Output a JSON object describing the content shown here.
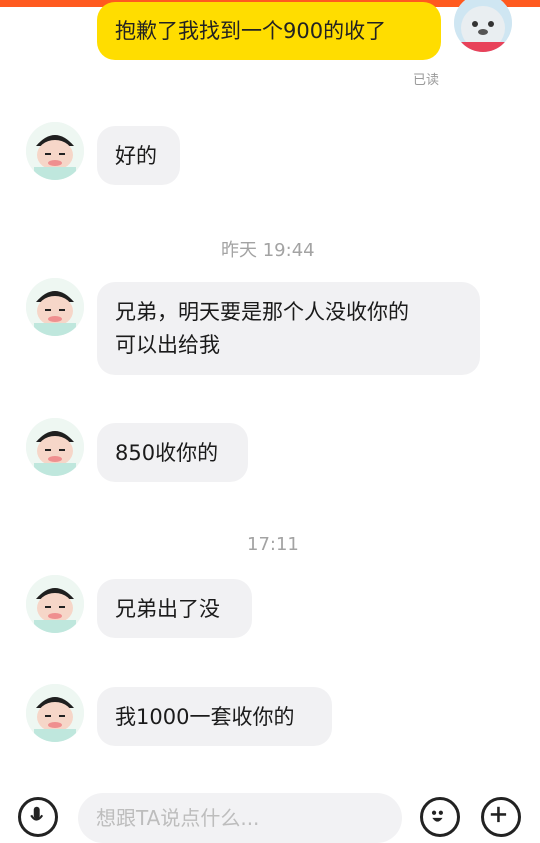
{
  "messages": {
    "m1": {
      "text": "抱歉了我找到一个900的收了",
      "status": "已读"
    },
    "m2": {
      "text": "好的"
    },
    "time1": "昨天 19:44",
    "m3": {
      "line1": "兄弟，明天要是那个人没收你的",
      "line2": "可以出给我"
    },
    "m4": {
      "text": "850收你的"
    },
    "time2": "17:11",
    "m5": {
      "text": "兄弟出了没"
    },
    "m6": {
      "text": "我1000一套收你的"
    }
  },
  "input_bar": {
    "placeholder": "想跟TA说点什么...",
    "icons": [
      "microphone-icon",
      "emoji-icon",
      "plus-icon"
    ]
  },
  "colors": {
    "accent_top": "#ff5a1f",
    "my_bubble": "#ffdd00",
    "their_bubble": "#f1f1f3"
  }
}
